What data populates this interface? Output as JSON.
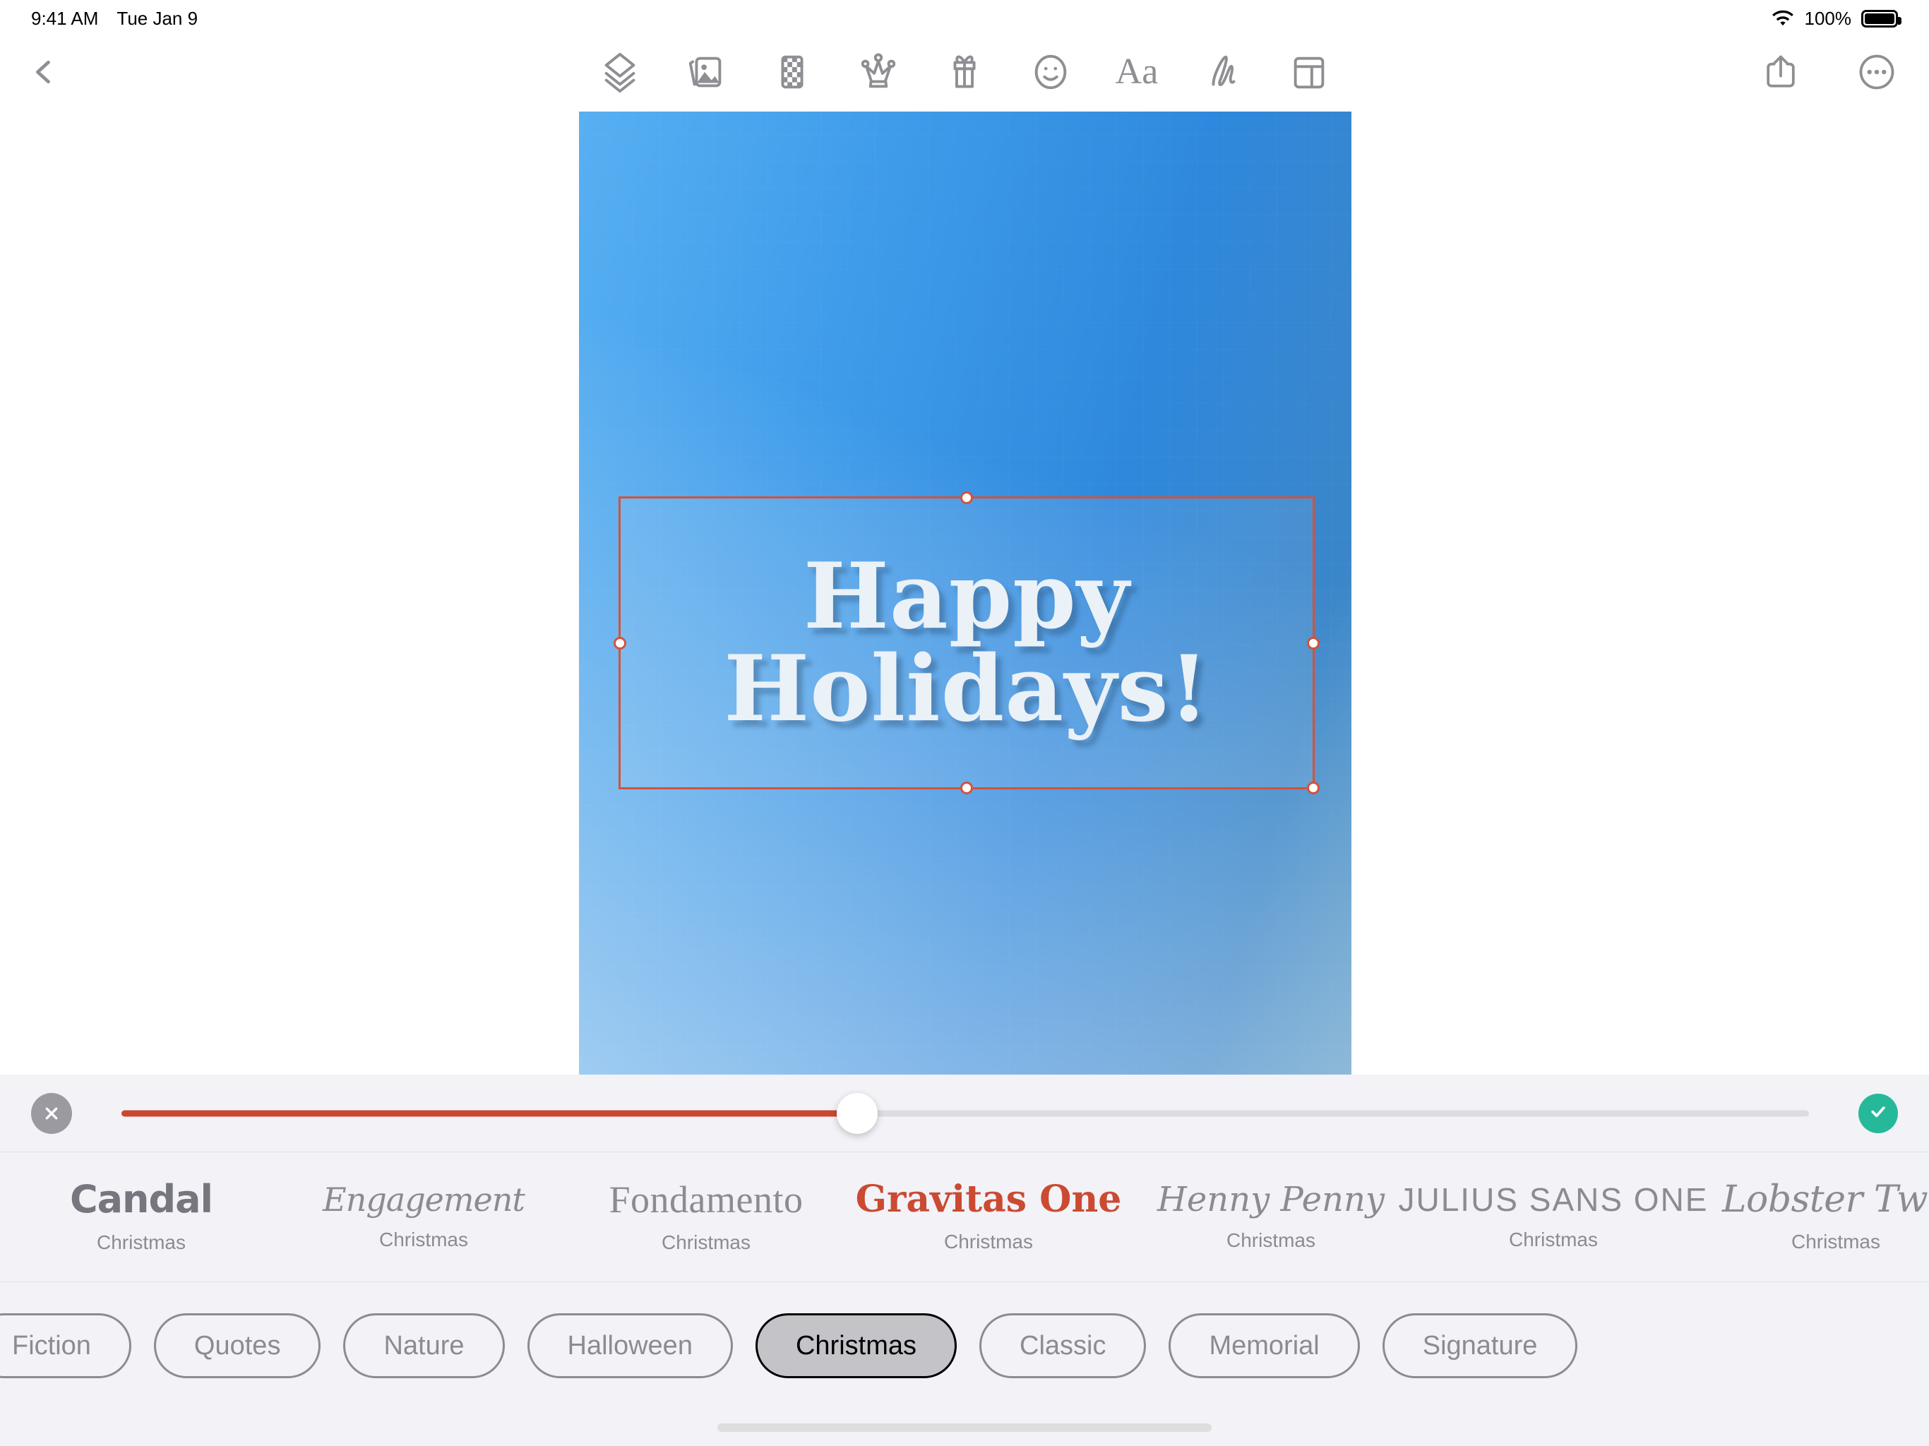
{
  "status_bar": {
    "time": "9:41 AM",
    "date": "Tue Jan 9",
    "battery_percent": "100%",
    "wifi_icon": "wifi-icon",
    "battery_icon": "battery-full-icon"
  },
  "toolbar": {
    "back_icon": "chevron-left-icon",
    "items": [
      {
        "name": "layers-icon",
        "label": "Layers"
      },
      {
        "name": "photos-icon",
        "label": "Photos"
      },
      {
        "name": "pattern-icon",
        "label": "Patterns"
      },
      {
        "name": "crown-icon",
        "label": "Premium"
      },
      {
        "name": "gift-icon",
        "label": "Gifts"
      },
      {
        "name": "smiley-icon",
        "label": "Stickers"
      },
      {
        "name": "text-icon",
        "label": "Aa"
      },
      {
        "name": "signature-icon",
        "label": "Draw"
      },
      {
        "name": "layout-icon",
        "label": "Layout"
      }
    ],
    "text_tool_label": "Aa",
    "share_icon": "share-icon",
    "more_icon": "more-circle-icon"
  },
  "canvas": {
    "card_text_line1": "Happy",
    "card_text_line2": "Holidays!",
    "selection_color": "#d4523a",
    "background_colors": [
      "#58b0f2",
      "#2f88dd",
      "#5d9cc8"
    ]
  },
  "editor_panel": {
    "close_icon": "close-x-icon",
    "confirm_icon": "check-circle-icon",
    "slider": {
      "name": "font-size-slider",
      "value_percent": 43.6,
      "fill_color": "#c8492f",
      "track_color": "#dcdce2"
    },
    "fonts": [
      {
        "sample": "Candal",
        "caption": "Christmas",
        "style": "f-candal",
        "selected": false
      },
      {
        "sample": "Engagement",
        "caption": "Christmas",
        "style": "f-engagement",
        "selected": false
      },
      {
        "sample": "Fondamento",
        "caption": "Christmas",
        "style": "f-fondamento",
        "selected": false
      },
      {
        "sample": "Gravitas One",
        "caption": "Christmas",
        "style": "f-gravitas",
        "selected": true
      },
      {
        "sample": "Henny Penny",
        "caption": "Christmas",
        "style": "f-henny",
        "selected": false
      },
      {
        "sample": "JULIUS SANS ONE",
        "caption": "Christmas",
        "style": "f-julius",
        "selected": false
      },
      {
        "sample": "Lobster Two",
        "caption": "Christmas",
        "style": "f-lobster",
        "selected": false
      }
    ],
    "categories": [
      {
        "label": "Fiction",
        "selected": false
      },
      {
        "label": "Quotes",
        "selected": false
      },
      {
        "label": "Nature",
        "selected": false
      },
      {
        "label": "Halloween",
        "selected": false
      },
      {
        "label": "Christmas",
        "selected": true
      },
      {
        "label": "Classic",
        "selected": false
      },
      {
        "label": "Memorial",
        "selected": false
      },
      {
        "label": "Signature",
        "selected": false
      }
    ],
    "selected_category": "Christmas",
    "selected_font": "Gravitas One"
  }
}
